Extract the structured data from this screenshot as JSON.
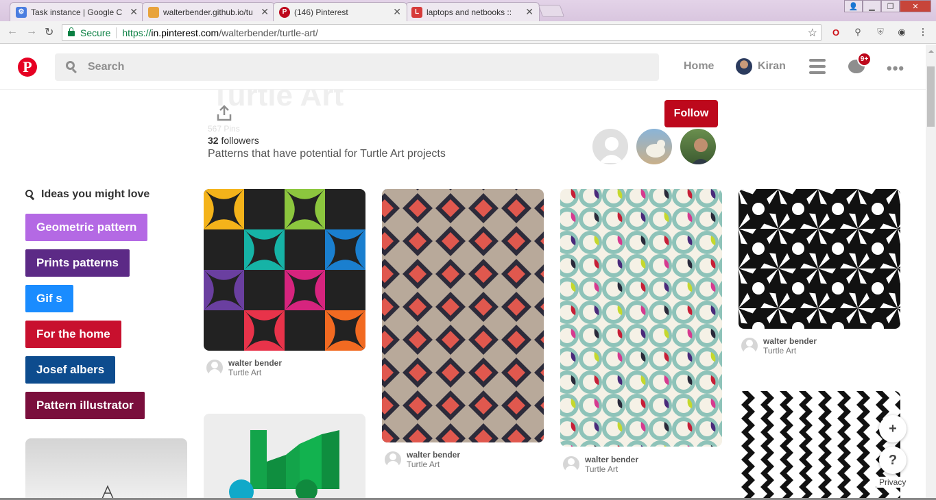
{
  "browser": {
    "tabs": [
      {
        "title": "Task instance | Google C",
        "color": "#4a7de0"
      },
      {
        "title": "walterbender.github.io/tu",
        "color": "#e8a33c"
      },
      {
        "title": "(146) Pinterest",
        "color": "#bd081c"
      },
      {
        "title": "laptops and netbooks :: ",
        "color": "#d63a3a",
        "icon_text": "L"
      }
    ],
    "omnibox": {
      "secure_label": "Secure",
      "url_proto": "https://",
      "url_host": "in.pinterest.com",
      "url_path": "/walterbender/turtle-art/"
    }
  },
  "header": {
    "search_placeholder": "Search",
    "home_label": "Home",
    "user_name": "Kiran",
    "notification_badge": "9+"
  },
  "board": {
    "ghost_title": "Turtle Art",
    "ghost_pins": "567 Pins",
    "followers_count": "32",
    "followers_label": " followers",
    "description": "Patterns that have potential for Turtle Art projects",
    "follow_label": "Follow"
  },
  "ideas": {
    "heading": "Ideas you might love",
    "items": [
      {
        "label": "Geometric pattern",
        "color": "#b469e4"
      },
      {
        "label": "Prints patterns",
        "color": "#5c2a86"
      },
      {
        "label": "Gif s",
        "color": "#1a8cff"
      },
      {
        "label": "For the home",
        "color": "#c8102e"
      },
      {
        "label": "Josef albers",
        "color": "#0d4c8e"
      },
      {
        "label": "Pattern illustrator",
        "color": "#7a0e3c"
      }
    ]
  },
  "pins": [
    {
      "author": "walter bender",
      "board": "Turtle Art"
    },
    {
      "author": "walter bender",
      "board": "Turtle Art"
    },
    {
      "author": "walter bender",
      "board": "Turtle Art"
    },
    {
      "author": "walter bender",
      "board": "Turtle Art"
    }
  ],
  "footer": {
    "add_label": "+",
    "help_label": "?",
    "privacy_label": "Privacy"
  }
}
